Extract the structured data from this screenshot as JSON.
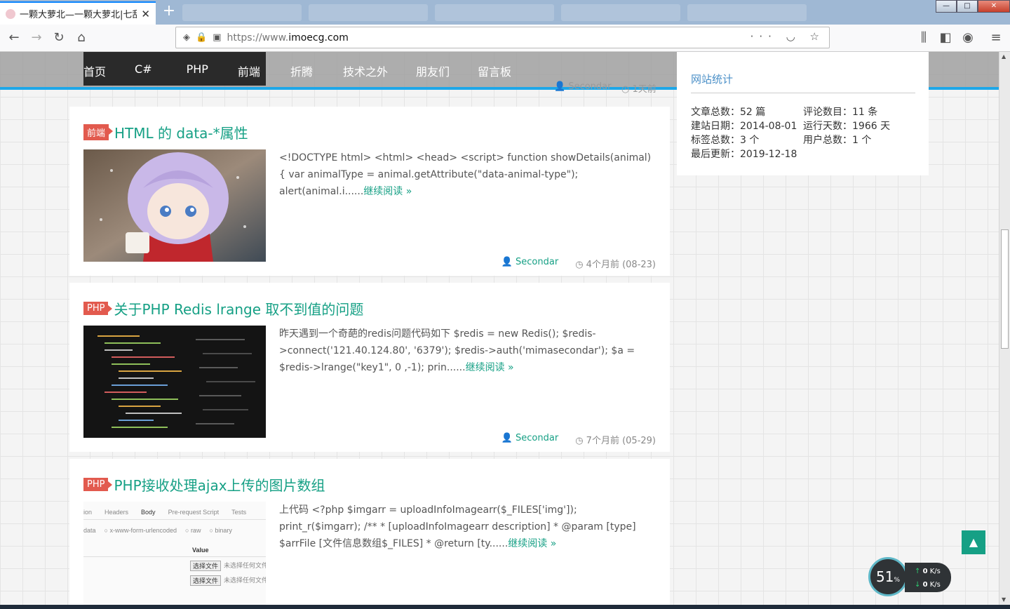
{
  "browser": {
    "tab_title": "一颗大萝北—一颗大萝北|七乱八",
    "new_tab": "+",
    "url_proto": "https://www.",
    "url_host": "imoecg.com",
    "win_min": "—",
    "win_max": "□",
    "win_close": "✕"
  },
  "site_nav": {
    "items": [
      "首页",
      "C#",
      "PHP",
      "前端",
      "折腾",
      "技术之外",
      "朋友们",
      "留言板"
    ],
    "peek_author": "Secondar",
    "peek_time": "1天前"
  },
  "posts": [
    {
      "badge": "前端",
      "title": "HTML 的 data-*属性",
      "excerpt": "<!DOCTYPE html> <html> <head> <script> function showDetails(animal) { var animalType = animal.getAttribute(\"data-animal-type\"); alert(animal.i......",
      "more": "继续阅读 »",
      "author": "Secondar",
      "time": "4个月前 (08-23)"
    },
    {
      "badge": "PHP",
      "title": "关于PHP Redis lrange 取不到值的问题",
      "excerpt": "昨天遇到一个奇葩的redis问题代码如下 $redis = new Redis(); $redis->connect('121.40.124.80', '6379'); $redis->auth('mimasecondar'); $a = $redis->lrange(\"key1\", 0 ,-1); prin......",
      "more": "继续阅读 »",
      "author": "Secondar",
      "time": "7个月前 (05-29)"
    },
    {
      "badge": "PHP",
      "title": "PHP接收处理ajax上传的图片数组",
      "excerpt": "上代码 <?php $imgarr = uploadInfoImagearr($_FILES['img']); print_r($imgarr); /** * [uploadInfoImagearr description] * @param [type] $arrFile [文件信息数组$_FILES] * @return [ty......",
      "more": "继续阅读 »"
    }
  ],
  "postman_thumb": {
    "tabs": [
      "ion",
      "Headers",
      "Body",
      "Pre-request Script",
      "Tests"
    ],
    "options": [
      "data",
      "x-www-form-urlencoded",
      "raw",
      "binary"
    ],
    "value_header": "Value",
    "btn": "选择文件",
    "note": "未选择任何文件"
  },
  "sidebar": {
    "title": "网站统计",
    "stats": [
      [
        "文章总数：52 篇",
        "评论数目：11 条"
      ],
      [
        "建站日期：2014-08-01",
        "运行天数：1966 天"
      ],
      [
        "标签总数：3 个",
        "用户总数：1 个"
      ],
      [
        "最后更新：2019-12-18",
        ""
      ]
    ]
  },
  "netmon": {
    "percent": "51",
    "percent_unit": "%",
    "up": "0",
    "down": "0",
    "unit": "K/s"
  },
  "colors": {
    "accent": "#1ea7e8",
    "link": "#16a085",
    "badge": "#e25a4e"
  }
}
